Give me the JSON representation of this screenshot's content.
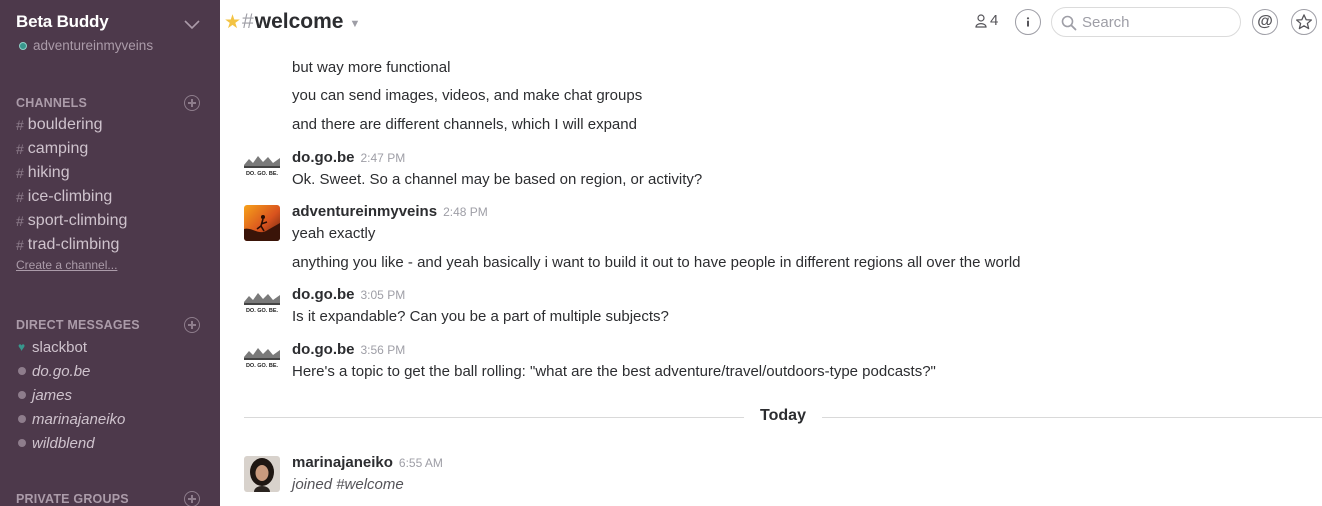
{
  "team": {
    "name": "Beta Buddy",
    "user": "adventureinmyveins"
  },
  "channels": {
    "heading": "CHANNELS",
    "items": [
      {
        "label": "bouldering"
      },
      {
        "label": "camping"
      },
      {
        "label": "hiking"
      },
      {
        "label": "ice-climbing"
      },
      {
        "label": "sport-climbing"
      },
      {
        "label": "trad-climbing"
      }
    ],
    "create_label": "Create a channel..."
  },
  "direct_messages": {
    "heading": "DIRECT MESSAGES",
    "items": [
      {
        "label": "slackbot"
      },
      {
        "label": "do.go.be"
      },
      {
        "label": "james"
      },
      {
        "label": "marinajaneiko"
      },
      {
        "label": "wildblend"
      }
    ]
  },
  "private_groups": {
    "heading": "PRIVATE GROUPS"
  },
  "header": {
    "channel": "welcome",
    "member_count": "4",
    "search_placeholder": "Search"
  },
  "messages": {
    "continuation": [
      "but way more functional",
      "you can send images, videos, and make chat groups",
      "and there are different channels, which I will expand"
    ],
    "posts": [
      {
        "author": "do.go.be",
        "time": "2:47 PM",
        "lines": [
          "Ok. Sweet. So a channel may be based on region, or activity?"
        ]
      },
      {
        "author": "adventureinmyveins",
        "time": "2:48 PM",
        "lines": [
          "yeah exactly",
          "anything you like - and yeah basically i want to build it out to have people in different regions all over the world"
        ]
      },
      {
        "author": "do.go.be",
        "time": "3:05 PM",
        "lines": [
          "Is it expandable? Can you be a part of multiple subjects?"
        ]
      },
      {
        "author": "do.go.be",
        "time": "3:56 PM",
        "lines": [
          "Here's a topic to get the ball rolling: \"what are the best adventure/travel/outdoors-type podcasts?\""
        ]
      }
    ],
    "divider": "Today",
    "today_posts": [
      {
        "author": "marinajaneiko",
        "time": "6:55 AM",
        "lines": [
          "joined #welcome"
        ]
      }
    ],
    "avatar_logo_text": "DO. GO. BE."
  },
  "colors": {
    "sidebar_bg": "#4d394b",
    "presence": "#38978d",
    "star": "#f3c343"
  }
}
